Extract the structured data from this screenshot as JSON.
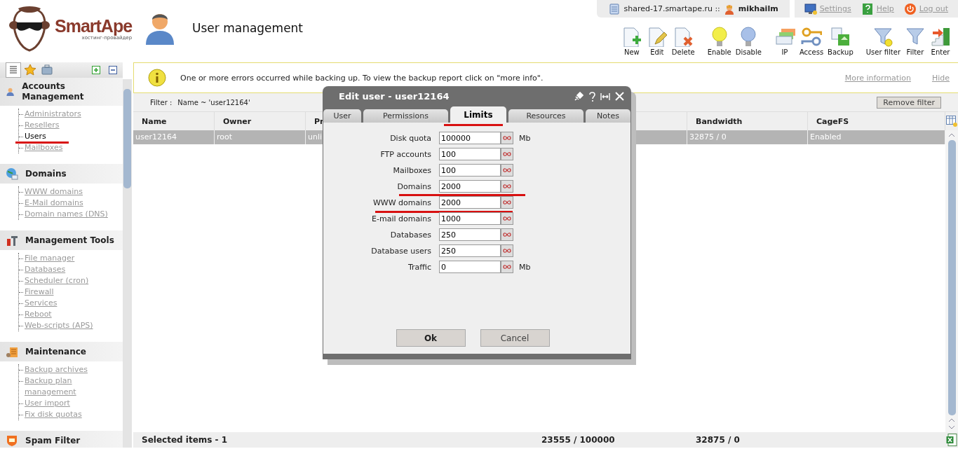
{
  "header": {
    "logo": {
      "name": "SmartApe",
      "tagline": "хостинг-провайдер"
    },
    "title": "User management"
  },
  "server_bar": {
    "host": "shared-17.smartape.ru ::",
    "user": "mikhailm"
  },
  "top_links": [
    {
      "kind": "settings",
      "label": "Settings"
    },
    {
      "kind": "help",
      "label": "Help"
    },
    {
      "kind": "logout",
      "label": "Log out"
    }
  ],
  "toolbar": [
    [
      {
        "kind": "new",
        "label": "New"
      },
      {
        "kind": "edit",
        "label": "Edit"
      },
      {
        "kind": "delete",
        "label": "Delete"
      }
    ],
    [
      {
        "kind": "enable",
        "label": "Enable"
      },
      {
        "kind": "disable",
        "label": "Disable"
      }
    ],
    [
      {
        "kind": "ip",
        "label": "IP"
      },
      {
        "kind": "access",
        "label": "Access"
      },
      {
        "kind": "backup",
        "label": "Backup"
      }
    ],
    [
      {
        "kind": "user-filter",
        "label": "User filter"
      },
      {
        "kind": "filter",
        "label": "Filter"
      },
      {
        "kind": "enter",
        "label": "Enter"
      }
    ]
  ],
  "sidebar": {
    "view_tabs": [
      {
        "kind": "tree",
        "selected": true
      },
      {
        "kind": "favorites",
        "selected": false
      },
      {
        "kind": "catalog",
        "selected": false
      }
    ],
    "sections": [
      {
        "kind": "accounts",
        "title": "Accounts Management",
        "items": [
          {
            "label": "Administrators",
            "selected": false,
            "underlined": false
          },
          {
            "label": "Resellers",
            "selected": false,
            "underlined": false
          },
          {
            "label": "Users",
            "selected": true,
            "underlined": true
          },
          {
            "label": "Mailboxes",
            "selected": false,
            "underlined": false
          }
        ]
      },
      {
        "kind": "domains",
        "title": "Domains",
        "items": [
          {
            "label": "WWW domains",
            "selected": false,
            "underlined": false
          },
          {
            "label": "E-Mail domains",
            "selected": false,
            "underlined": false
          },
          {
            "label": "Domain names (DNS)",
            "selected": false,
            "underlined": false
          }
        ]
      },
      {
        "kind": "tools",
        "title": "Management Tools",
        "items": [
          {
            "label": "File manager",
            "selected": false,
            "underlined": false
          },
          {
            "label": "Databases",
            "selected": false,
            "underlined": false
          },
          {
            "label": "Scheduler (cron)",
            "selected": false,
            "underlined": false
          },
          {
            "label": "Firewall",
            "selected": false,
            "underlined": false
          },
          {
            "label": "Services",
            "selected": false,
            "underlined": false
          },
          {
            "label": "Reboot",
            "selected": false,
            "underlined": false
          },
          {
            "label": "Web-scripts (APS)",
            "selected": false,
            "underlined": false
          }
        ]
      },
      {
        "kind": "maintenance",
        "title": "Maintenance",
        "items": [
          {
            "label": "Backup archives",
            "selected": false,
            "underlined": false
          },
          {
            "label": "Backup plan management",
            "selected": false,
            "underlined": false
          },
          {
            "label": "User import",
            "selected": false,
            "underlined": false
          },
          {
            "label": "Fix disk quotas",
            "selected": false,
            "underlined": false
          }
        ]
      },
      {
        "kind": "spam",
        "title": "Spam Filter"
      }
    ]
  },
  "alert": {
    "message": "One or more errors occurred while backing up. To view the backup report click on \"more info\".",
    "links": [
      "More information",
      "Hide"
    ]
  },
  "filter": {
    "label": "Filter :",
    "value": "Name ~ 'user12164'",
    "button": "Remove filter"
  },
  "table": {
    "columns": [
      "Name",
      "Owner",
      "Pr",
      "Bandwidth",
      "CageFS"
    ],
    "rows": [
      {
        "cells": [
          "user12164",
          "root",
          "unli",
          "32875 / 0",
          "Enabled"
        ],
        "selected": true
      }
    ],
    "footer": [
      "Selected items - 1",
      "23555 / 100000",
      "32875 / 0"
    ]
  },
  "dialog": {
    "title": "Edit user - user12164",
    "tabs": [
      {
        "label": "User",
        "selected": false,
        "underlined": false
      },
      {
        "label": "Permissions",
        "selected": false,
        "underlined": false
      },
      {
        "label": "Limits",
        "selected": true,
        "underlined": true
      },
      {
        "label": "Resources",
        "selected": false,
        "underlined": false
      },
      {
        "label": "Notes",
        "selected": false,
        "underlined": false
      }
    ],
    "limits": [
      {
        "label": "Disk quota",
        "value": "100000",
        "unit": "Mb",
        "underlined": false
      },
      {
        "label": "FTP accounts",
        "value": "100",
        "underlined": false
      },
      {
        "label": "Mailboxes",
        "value": "100",
        "underlined": false
      },
      {
        "label": "Domains",
        "value": "2000",
        "underlined": true
      },
      {
        "label": "WWW domains",
        "value": "2000",
        "underlined": true
      },
      {
        "label": "E-mail domains",
        "value": "1000",
        "underlined": false
      },
      {
        "label": "Databases",
        "value": "250",
        "underlined": false
      },
      {
        "label": "Database users",
        "value": "250",
        "underlined": false
      },
      {
        "label": "Traffic",
        "value": "0",
        "unit": "Mb",
        "underlined": false
      }
    ],
    "buttons": [
      {
        "label": "Ok",
        "default": true
      },
      {
        "label": "Cancel",
        "default": false
      }
    ]
  }
}
